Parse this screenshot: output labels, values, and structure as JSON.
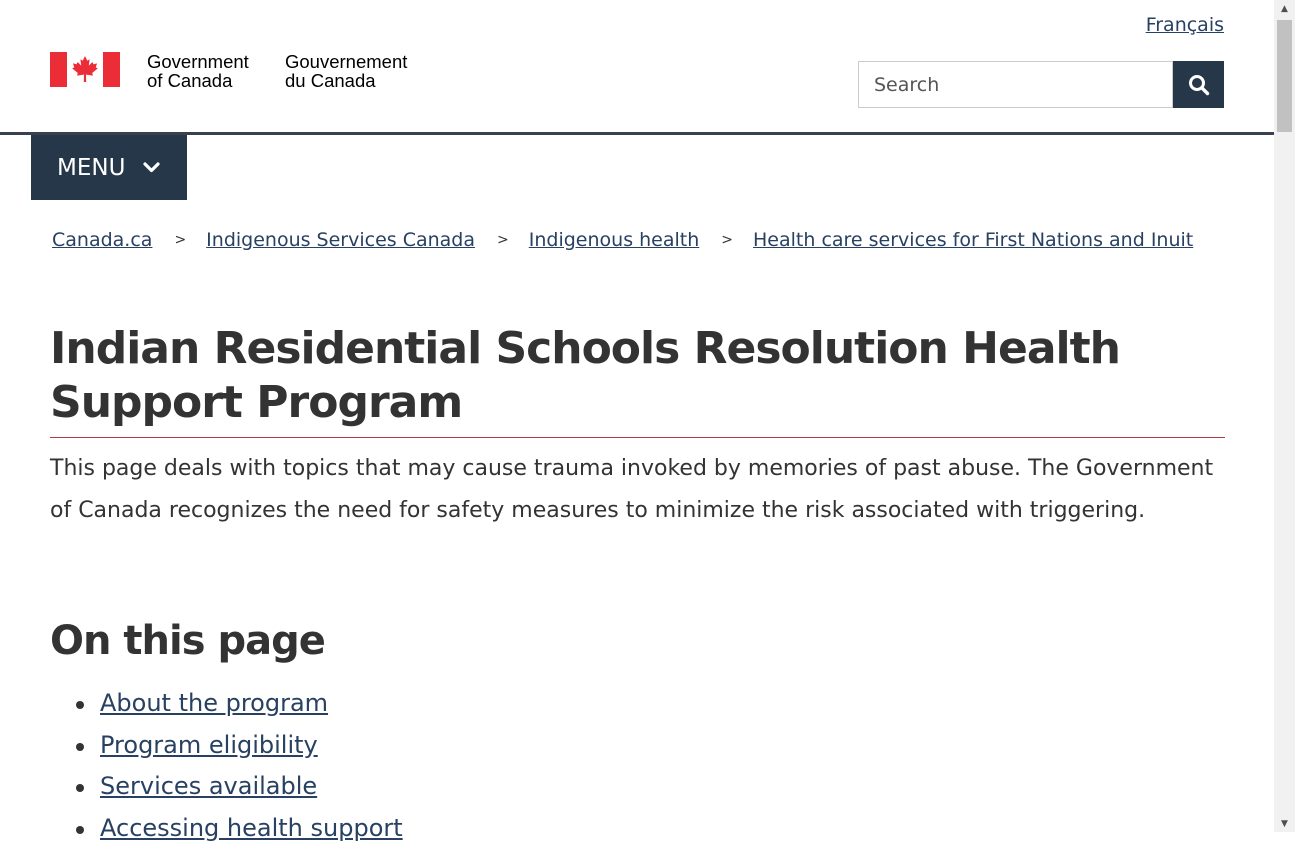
{
  "header": {
    "language_link": "Français",
    "signature_en": [
      "Government",
      "of Canada"
    ],
    "signature_fr": [
      "Gouvernement",
      "du Canada"
    ],
    "search": {
      "placeholder": "Search",
      "value": ""
    },
    "menu_label": "MENU"
  },
  "breadcrumb": [
    {
      "label": "Canada.ca"
    },
    {
      "label": "Indigenous Services Canada"
    },
    {
      "label": "Indigenous health"
    },
    {
      "label": "Health care services for First Nations and Inuit"
    }
  ],
  "breadcrumb_separator": ">",
  "main": {
    "title": "Indian Residential Schools Resolution Health Support Program",
    "intro": "This page deals with topics that may cause trauma invoked by memories of past abuse. The Government of Canada recognizes the need for safety measures to minimize the risk associated with triggering.",
    "toc_heading": "On this page",
    "toc": [
      "About the program",
      "Program eligibility",
      "Services available",
      "Accessing health support"
    ]
  },
  "colors": {
    "flag_red": "#eb2d37",
    "nav_dark": "#26374a",
    "link": "#284162",
    "title_rule": "#af3c43"
  },
  "icons": {
    "search_button": "magnifying-glass-icon",
    "menu": "chevron-down-icon",
    "flag": "canada-flag-icon"
  }
}
